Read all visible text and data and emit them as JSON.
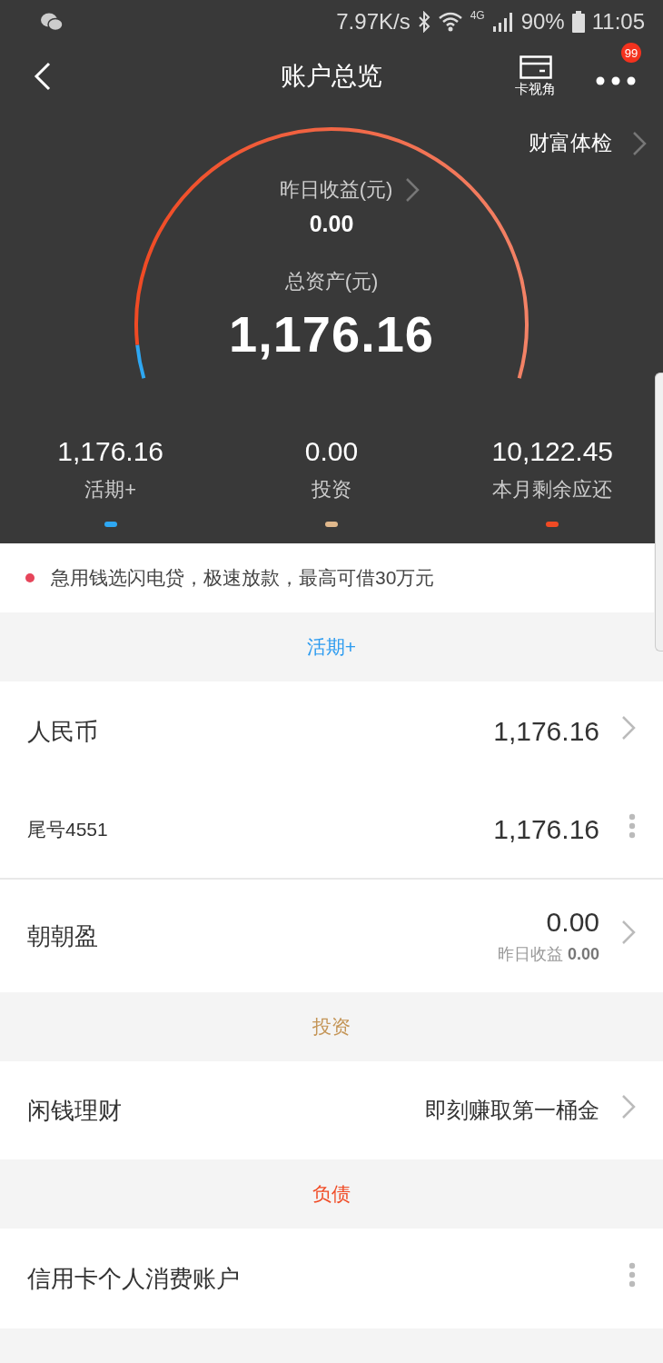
{
  "status_bar": {
    "speed": "7.97K/s",
    "network": "4G",
    "battery": "90%",
    "time": "11:05"
  },
  "header": {
    "title": "账户总览",
    "card_view": "卡视角",
    "badge": "99"
  },
  "wealth_check": "财富体检",
  "gauge": {
    "yesterday_label": "昨日收益(元)",
    "yesterday_value": "0.00",
    "total_label": "总资产(元)",
    "total_value": "1,176.16"
  },
  "summary": [
    {
      "value": "1,176.16",
      "label": "活期+",
      "color": "#2ea7f2"
    },
    {
      "value": "0.00",
      "label": "投资",
      "color": "#e0b88c"
    },
    {
      "value": "10,122.45",
      "label": "本月剩余应还",
      "color": "#f04a24"
    }
  ],
  "notice": "急用钱选闪电贷，极速放款，最高可借30万元",
  "sections": [
    {
      "title": "活期+",
      "color": "#2e9cf0",
      "rows": [
        {
          "kind": "main",
          "label": "人民币",
          "value": "1,176.16",
          "action": {
            "kind": "chevron"
          }
        },
        {
          "kind": "sub",
          "label": "尾号4551",
          "value": "1,176.16",
          "action": {
            "kind": "more"
          }
        },
        {
          "kind": "main",
          "label": "朝朝盈",
          "value": "0.00",
          "note_label": "昨日收益",
          "note_value": "0.00",
          "action": {
            "kind": "chevron"
          }
        }
      ]
    },
    {
      "title": "投资",
      "color": "#c49557",
      "rows": [
        {
          "kind": "link",
          "label": "闲钱理财",
          "value": "即刻赚取第一桶金",
          "action": {
            "kind": "chevron"
          }
        }
      ]
    },
    {
      "title": "负债",
      "color": "#f04a24",
      "rows": [
        {
          "kind": "main",
          "label": "信用卡个人消费账户",
          "action": {
            "kind": "more"
          }
        }
      ]
    }
  ]
}
